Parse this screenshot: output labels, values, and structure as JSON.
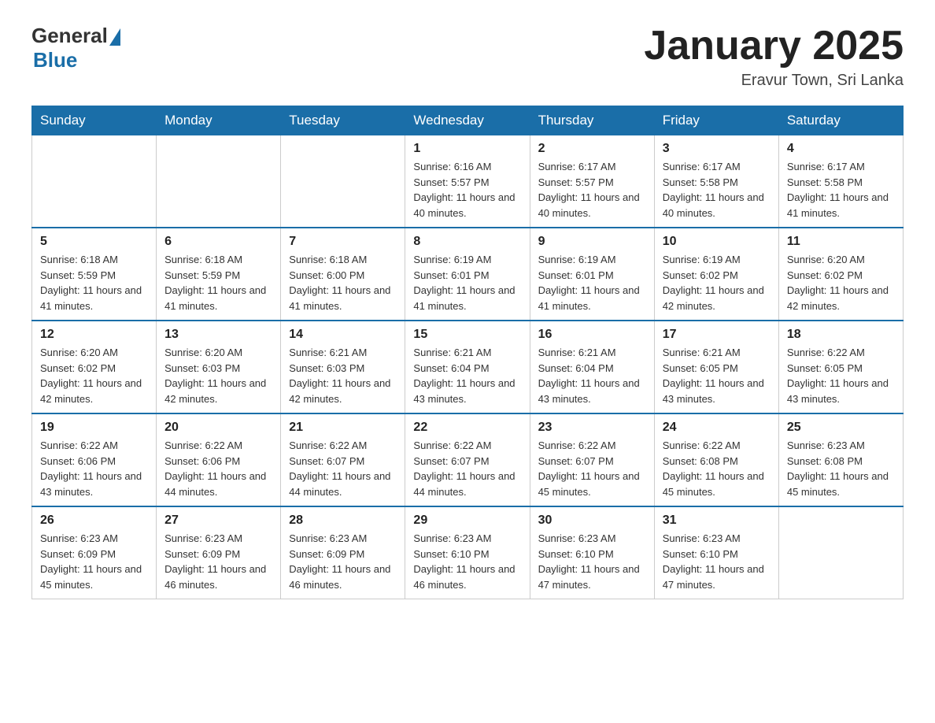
{
  "logo": {
    "general": "General",
    "blue": "Blue"
  },
  "title": "January 2025",
  "location": "Eravur Town, Sri Lanka",
  "days_of_week": [
    "Sunday",
    "Monday",
    "Tuesday",
    "Wednesday",
    "Thursday",
    "Friday",
    "Saturday"
  ],
  "weeks": [
    [
      {
        "day": "",
        "info": ""
      },
      {
        "day": "",
        "info": ""
      },
      {
        "day": "",
        "info": ""
      },
      {
        "day": "1",
        "info": "Sunrise: 6:16 AM\nSunset: 5:57 PM\nDaylight: 11 hours and 40 minutes."
      },
      {
        "day": "2",
        "info": "Sunrise: 6:17 AM\nSunset: 5:57 PM\nDaylight: 11 hours and 40 minutes."
      },
      {
        "day": "3",
        "info": "Sunrise: 6:17 AM\nSunset: 5:58 PM\nDaylight: 11 hours and 40 minutes."
      },
      {
        "day": "4",
        "info": "Sunrise: 6:17 AM\nSunset: 5:58 PM\nDaylight: 11 hours and 41 minutes."
      }
    ],
    [
      {
        "day": "5",
        "info": "Sunrise: 6:18 AM\nSunset: 5:59 PM\nDaylight: 11 hours and 41 minutes."
      },
      {
        "day": "6",
        "info": "Sunrise: 6:18 AM\nSunset: 5:59 PM\nDaylight: 11 hours and 41 minutes."
      },
      {
        "day": "7",
        "info": "Sunrise: 6:18 AM\nSunset: 6:00 PM\nDaylight: 11 hours and 41 minutes."
      },
      {
        "day": "8",
        "info": "Sunrise: 6:19 AM\nSunset: 6:01 PM\nDaylight: 11 hours and 41 minutes."
      },
      {
        "day": "9",
        "info": "Sunrise: 6:19 AM\nSunset: 6:01 PM\nDaylight: 11 hours and 41 minutes."
      },
      {
        "day": "10",
        "info": "Sunrise: 6:19 AM\nSunset: 6:02 PM\nDaylight: 11 hours and 42 minutes."
      },
      {
        "day": "11",
        "info": "Sunrise: 6:20 AM\nSunset: 6:02 PM\nDaylight: 11 hours and 42 minutes."
      }
    ],
    [
      {
        "day": "12",
        "info": "Sunrise: 6:20 AM\nSunset: 6:02 PM\nDaylight: 11 hours and 42 minutes."
      },
      {
        "day": "13",
        "info": "Sunrise: 6:20 AM\nSunset: 6:03 PM\nDaylight: 11 hours and 42 minutes."
      },
      {
        "day": "14",
        "info": "Sunrise: 6:21 AM\nSunset: 6:03 PM\nDaylight: 11 hours and 42 minutes."
      },
      {
        "day": "15",
        "info": "Sunrise: 6:21 AM\nSunset: 6:04 PM\nDaylight: 11 hours and 43 minutes."
      },
      {
        "day": "16",
        "info": "Sunrise: 6:21 AM\nSunset: 6:04 PM\nDaylight: 11 hours and 43 minutes."
      },
      {
        "day": "17",
        "info": "Sunrise: 6:21 AM\nSunset: 6:05 PM\nDaylight: 11 hours and 43 minutes."
      },
      {
        "day": "18",
        "info": "Sunrise: 6:22 AM\nSunset: 6:05 PM\nDaylight: 11 hours and 43 minutes."
      }
    ],
    [
      {
        "day": "19",
        "info": "Sunrise: 6:22 AM\nSunset: 6:06 PM\nDaylight: 11 hours and 43 minutes."
      },
      {
        "day": "20",
        "info": "Sunrise: 6:22 AM\nSunset: 6:06 PM\nDaylight: 11 hours and 44 minutes."
      },
      {
        "day": "21",
        "info": "Sunrise: 6:22 AM\nSunset: 6:07 PM\nDaylight: 11 hours and 44 minutes."
      },
      {
        "day": "22",
        "info": "Sunrise: 6:22 AM\nSunset: 6:07 PM\nDaylight: 11 hours and 44 minutes."
      },
      {
        "day": "23",
        "info": "Sunrise: 6:22 AM\nSunset: 6:07 PM\nDaylight: 11 hours and 45 minutes."
      },
      {
        "day": "24",
        "info": "Sunrise: 6:22 AM\nSunset: 6:08 PM\nDaylight: 11 hours and 45 minutes."
      },
      {
        "day": "25",
        "info": "Sunrise: 6:23 AM\nSunset: 6:08 PM\nDaylight: 11 hours and 45 minutes."
      }
    ],
    [
      {
        "day": "26",
        "info": "Sunrise: 6:23 AM\nSunset: 6:09 PM\nDaylight: 11 hours and 45 minutes."
      },
      {
        "day": "27",
        "info": "Sunrise: 6:23 AM\nSunset: 6:09 PM\nDaylight: 11 hours and 46 minutes."
      },
      {
        "day": "28",
        "info": "Sunrise: 6:23 AM\nSunset: 6:09 PM\nDaylight: 11 hours and 46 minutes."
      },
      {
        "day": "29",
        "info": "Sunrise: 6:23 AM\nSunset: 6:10 PM\nDaylight: 11 hours and 46 minutes."
      },
      {
        "day": "30",
        "info": "Sunrise: 6:23 AM\nSunset: 6:10 PM\nDaylight: 11 hours and 47 minutes."
      },
      {
        "day": "31",
        "info": "Sunrise: 6:23 AM\nSunset: 6:10 PM\nDaylight: 11 hours and 47 minutes."
      },
      {
        "day": "",
        "info": ""
      }
    ]
  ]
}
